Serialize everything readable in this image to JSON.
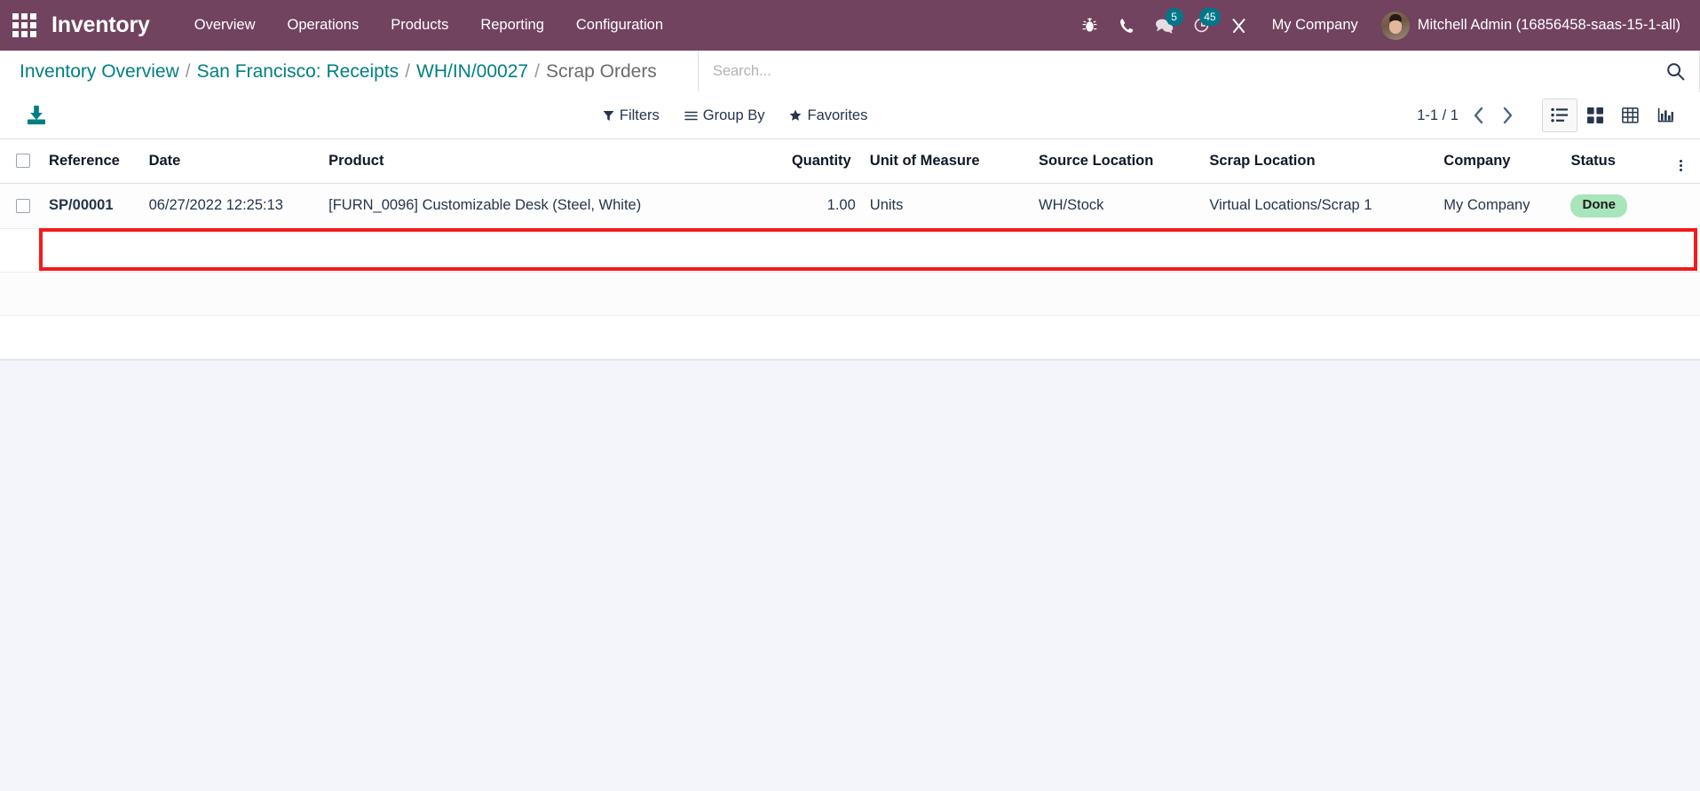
{
  "navbar": {
    "apps_icon": "apps-grid-icon",
    "brand": "Inventory",
    "menu": [
      {
        "label": "Overview"
      },
      {
        "label": "Operations"
      },
      {
        "label": "Products"
      },
      {
        "label": "Reporting"
      },
      {
        "label": "Configuration"
      }
    ],
    "icons": [
      {
        "name": "bug-icon",
        "badge": null
      },
      {
        "name": "phone-icon",
        "badge": null
      },
      {
        "name": "messages-icon",
        "badge": "5"
      },
      {
        "name": "activities-clock-icon",
        "badge": "45"
      },
      {
        "name": "tools-wrench-icon",
        "badge": null
      }
    ],
    "company": "My Company",
    "user": "Mitchell Admin (16856458-saas-15-1-all)",
    "colors": {
      "background": "#71435f",
      "badge": "#00788a",
      "text": "#ffffff"
    }
  },
  "breadcrumb": {
    "items": [
      {
        "label": "Inventory Overview",
        "current": false
      },
      {
        "label": "San Francisco: Receipts",
        "current": false
      },
      {
        "label": "WH/IN/00027",
        "current": false
      },
      {
        "label": "Scrap Orders",
        "current": true
      }
    ],
    "separator": "/",
    "link_color": "#017e84"
  },
  "search": {
    "placeholder": "Search...",
    "value": "",
    "icon": "search-icon"
  },
  "toolbar": {
    "export_icon": "download-export-icon",
    "filters_label": "Filters",
    "filters_icon": "filter-funnel-icon",
    "group_by_label": "Group By",
    "group_by_icon": "hamburger-lines-icon",
    "favorites_label": "Favorites",
    "favorites_icon": "star-icon",
    "pager": "1-1 / 1",
    "prev_icon": "chevron-left-icon",
    "next_icon": "chevron-right-icon",
    "views": [
      {
        "name": "list-view",
        "icon": "list-icon",
        "active": true
      },
      {
        "name": "kanban-view",
        "icon": "kanban-grid-icon",
        "active": false
      },
      {
        "name": "pivot-view",
        "icon": "pivot-table-icon",
        "active": false
      },
      {
        "name": "graph-view",
        "icon": "bar-chart-icon",
        "active": false
      }
    ]
  },
  "table": {
    "columns": [
      "Reference",
      "Date",
      "Product",
      "Quantity",
      "Unit of Measure",
      "Source Location",
      "Scrap Location",
      "Company",
      "Status"
    ],
    "optional_columns_icon": "vertical-dots-icon",
    "rows": [
      {
        "reference": "SP/00001",
        "date": "06/27/2022 12:25:13",
        "product": "[FURN_0096] Customizable Desk (Steel, White)",
        "quantity": "1.00",
        "uom": "Units",
        "source_location": "WH/Stock",
        "scrap_location": "Virtual Locations/Scrap 1",
        "company": "My Company",
        "status": "Done",
        "status_color": "#a9e5bb",
        "highlighted": true
      }
    ],
    "highlight_color": "#f31b1b"
  }
}
